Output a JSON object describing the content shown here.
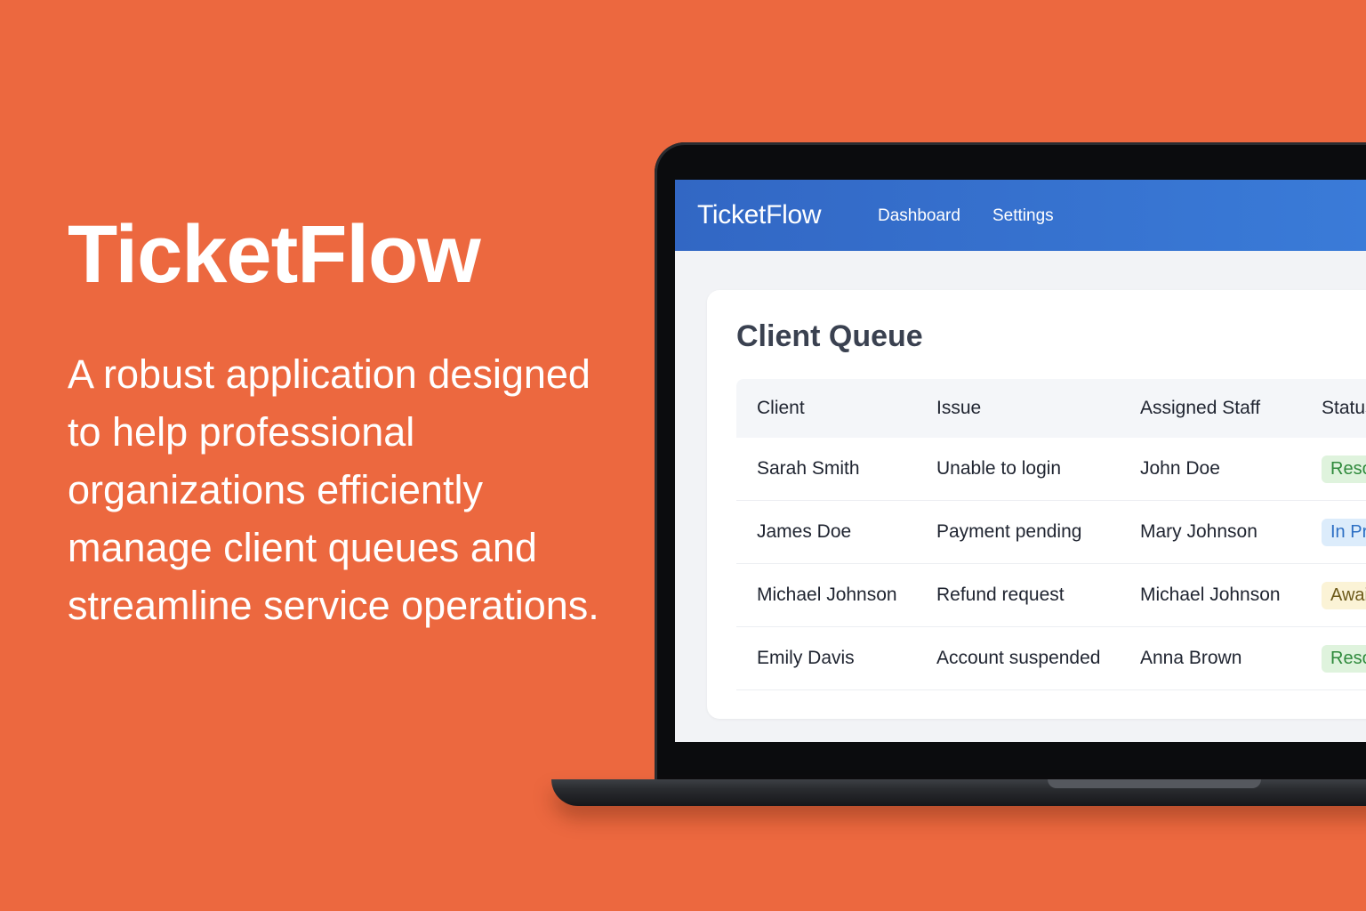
{
  "promo": {
    "title": "TicketFlow",
    "description": "A robust application designed to help professional organizations efficiently manage client queues and streamline service operations."
  },
  "app": {
    "brand": "TicketFlow",
    "nav": {
      "dashboard": "Dashboard",
      "settings": "Settings"
    }
  },
  "queue": {
    "title": "Client Queue",
    "columns": [
      "Client",
      "Issue",
      "Assigned Staff",
      "Status"
    ],
    "rows": [
      {
        "client": "Sarah Smith",
        "issue": "Unable to login",
        "staff": "John Doe",
        "status": "Resolved",
        "status_type": "resolved"
      },
      {
        "client": "James Doe",
        "issue": "Payment pending",
        "staff": "Mary Johnson",
        "status": "In Progress",
        "status_type": "progress"
      },
      {
        "client": "Michael Johnson",
        "issue": "Refund request",
        "staff": "Michael Johnson",
        "status": "Awaiting",
        "status_type": "awaiting"
      },
      {
        "client": "Emily Davis",
        "issue": "Account suspended",
        "staff": "Anna Brown",
        "status": "Resolved",
        "status_type": "resolved"
      }
    ]
  },
  "colors": {
    "background": "#EC683F",
    "nav": "#3267C4",
    "resolved": "#2F8A3C",
    "in_progress": "#2D6FC4",
    "awaiting": "#6D5A1A"
  }
}
